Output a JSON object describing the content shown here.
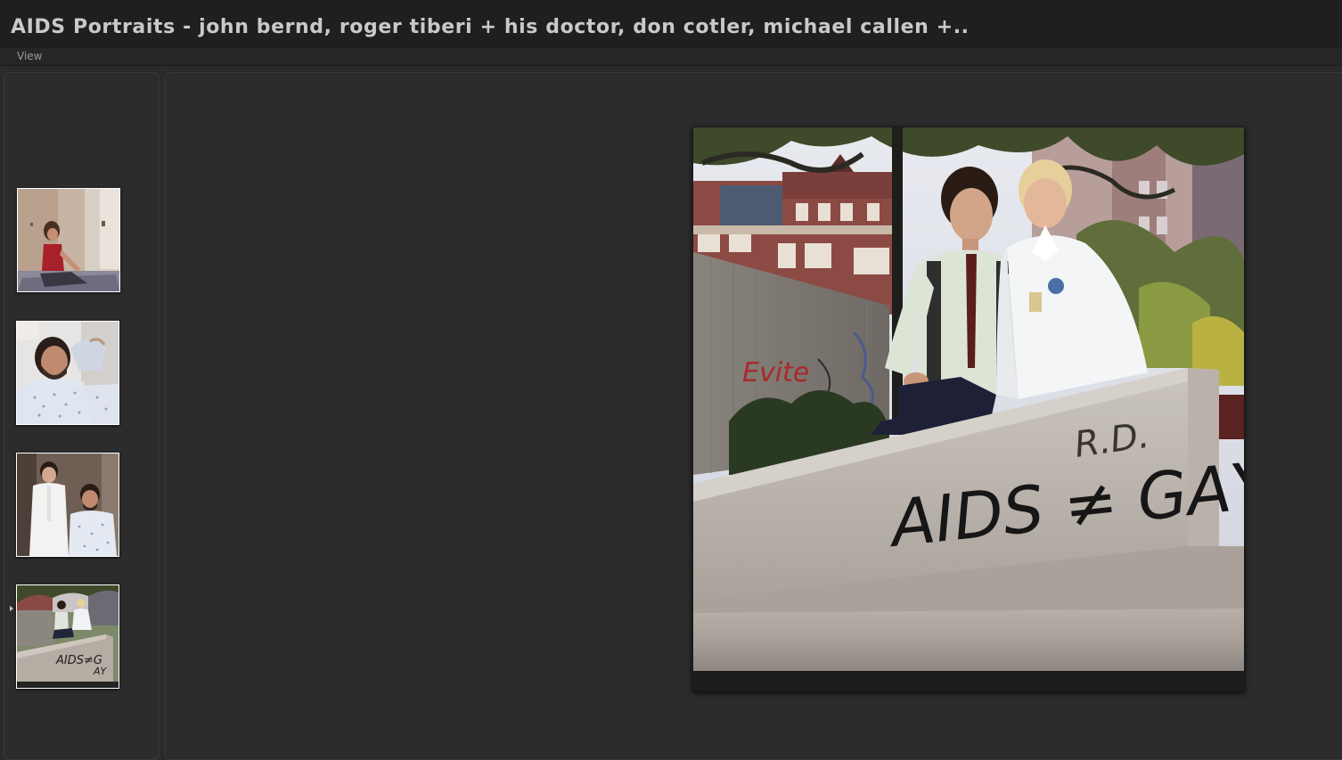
{
  "window": {
    "title": "AIDS Portraits - john bernd, roger tiberi + his doctor, don cotler, michael callen +.."
  },
  "menu": {
    "view_label": "View"
  },
  "thumbnails": [
    {
      "subject": "man sitting on bed in room",
      "selected": false
    },
    {
      "subject": "man in hospital gown lying in bed",
      "selected": false
    },
    {
      "subject": "doctor and patient portrait",
      "selected": false
    },
    {
      "subject": "two people sitting on graffiti wall",
      "selected": true
    }
  ],
  "main_photo": {
    "graffiti_text": "AIDS ≠ GAY",
    "initials_text": "R.D."
  }
}
